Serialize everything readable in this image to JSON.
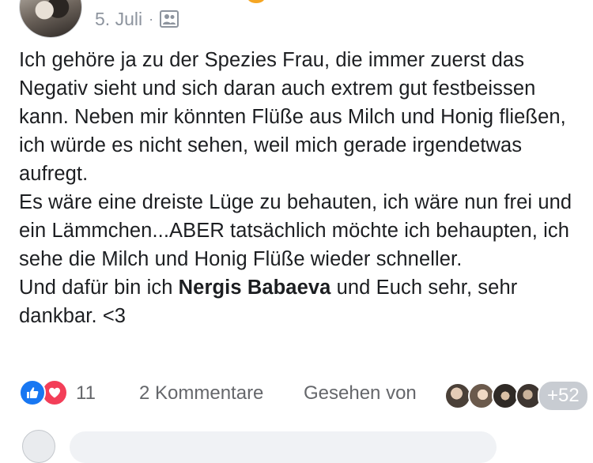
{
  "post": {
    "date": "5. Juli",
    "separator": "·",
    "audience_icon": "friends-group-icon",
    "text": {
      "p1": "Ich gehöre ja zu der Spezies Frau, die immer zuerst das Negativ sieht und sich daran auch extrem gut festbeissen kann. Neben mir könnten Flüße aus Milch und Honig fließen, ich würde es nicht sehen, weil mich gerade irgendetwas aufregt.",
      "p2": "Es wäre eine dreiste Lüge zu behauten, ich wäre nun frei und ein Lämmchen...ABER tatsächlich möchte ich behaupten, ich sehe die Milch und Honig Flüße wieder schneller.",
      "p3_before": "Und dafür bin ich ",
      "mention": "Nergis Babaeva",
      "p3_after": " und Euch sehr, sehr dankbar. <3"
    }
  },
  "stats": {
    "reactions": [
      "like-icon",
      "love-icon"
    ],
    "reaction_count": "11",
    "comments": "2 Kommentare",
    "seen_by": "Gesehen von",
    "more_viewers": "+52"
  },
  "colors": {
    "like": "#1877f2",
    "love": "#f33e58",
    "meta_text": "#8d949e",
    "body_text": "#1c1e21"
  }
}
